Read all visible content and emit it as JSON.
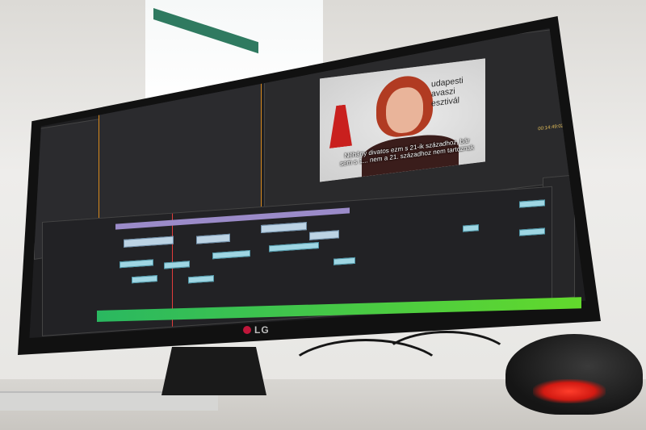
{
  "photo": {
    "monitor_brand": "LG",
    "application": {
      "program_monitor": {
        "video_title_lines": [
          "udapesti",
          "avaszi",
          "esztivál"
        ],
        "subtitle_lines": [
          "Néhány divatos ezm s 21-ik századhoz, bár",
          "sem s 1... nem a 21. századhoz nem tartoznak"
        ],
        "timecode": "00:14:49:02"
      }
    },
    "colors": {
      "accent_panel_border": "#d98a1e",
      "playhead": "#e23c3c",
      "video_clip": "#bcd3e4",
      "audio_clip": "#9fd6e3",
      "progress_bar": "#62d92c",
      "mouse_led": "#ff3d2b"
    },
    "icons": [
      "metronome-icon",
      "lg-logo-icon"
    ]
  }
}
